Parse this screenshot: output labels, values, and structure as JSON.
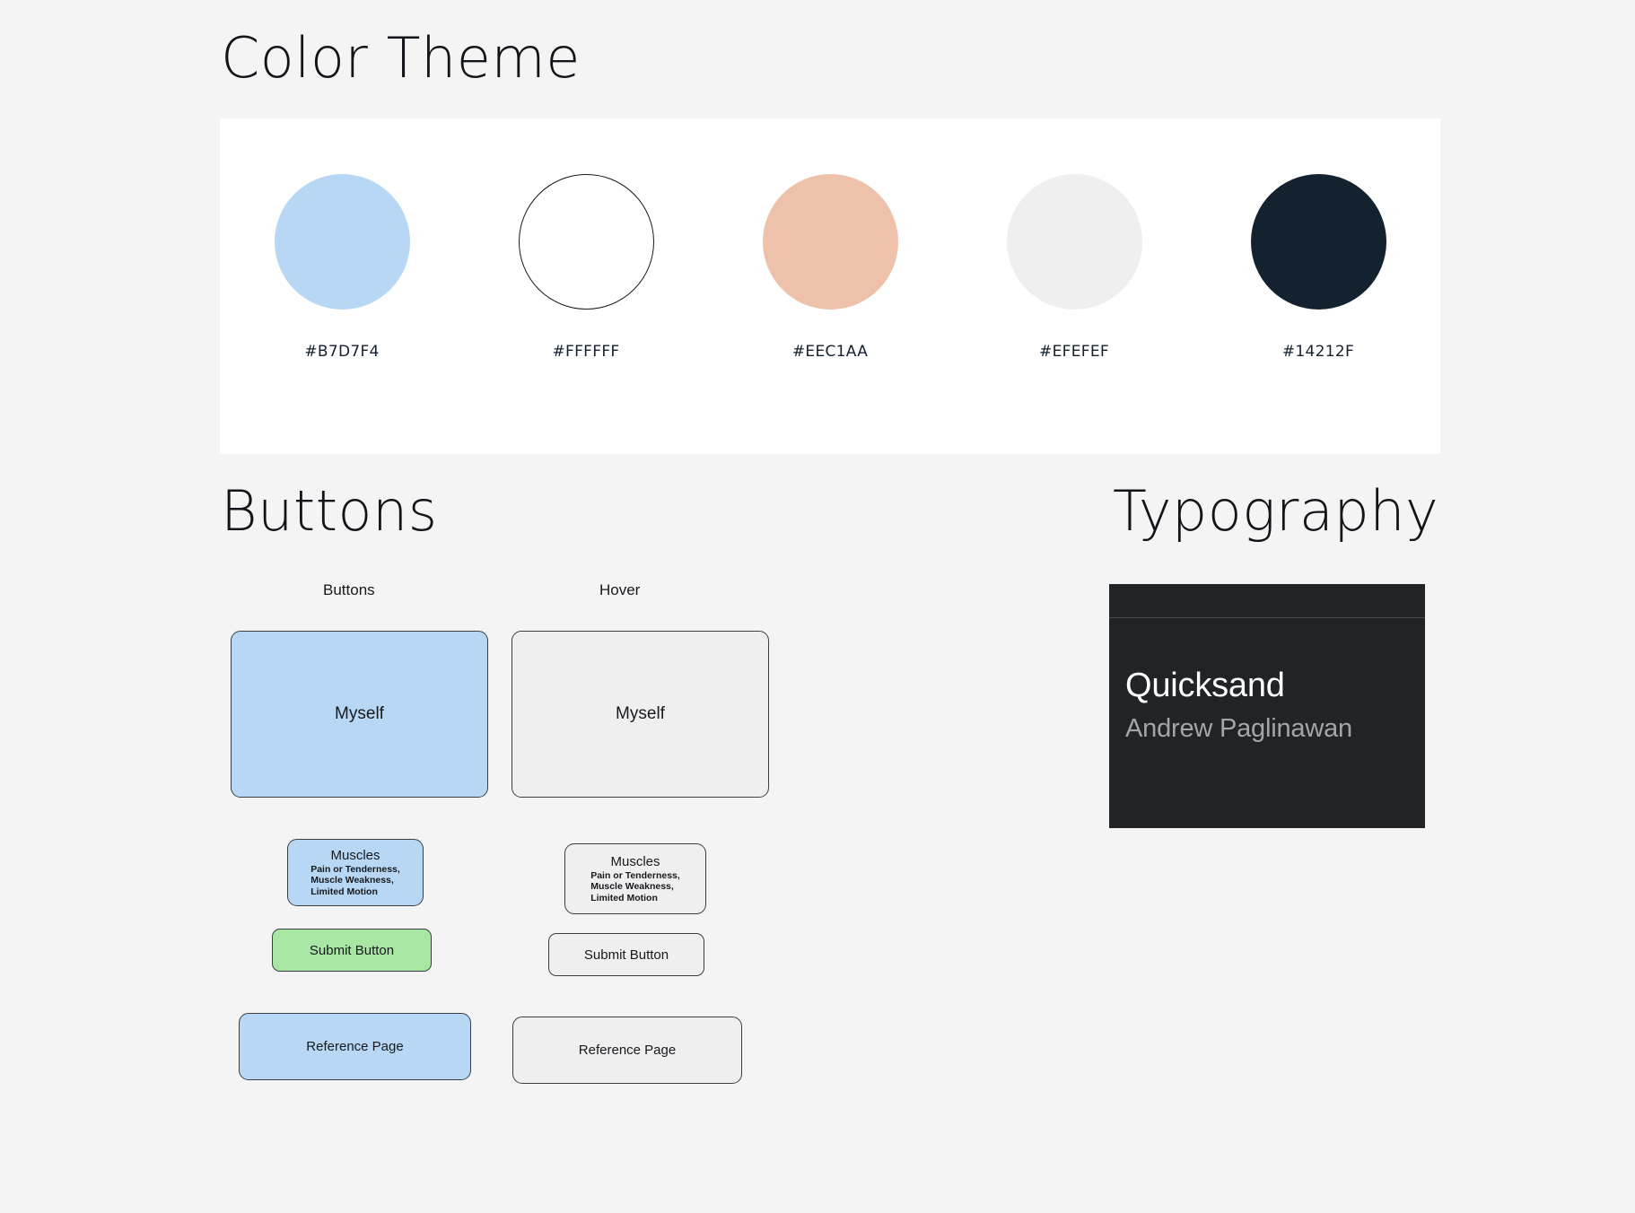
{
  "sections": {
    "color_theme": {
      "heading": "Color Theme",
      "swatches": [
        {
          "label": "#B7D7F4",
          "hex": "#B7D7F4",
          "outlined": false
        },
        {
          "label": "#FFFFFF",
          "hex": "#FFFFFF",
          "outlined": true
        },
        {
          "label": "#EEC1AA",
          "hex": "#EEC1AA",
          "outlined": false
        },
        {
          "label": "#EFEFEF",
          "hex": "#EFEFEF",
          "outlined": false
        },
        {
          "label": "#14212F",
          "hex": "#14212F",
          "outlined": false
        }
      ]
    },
    "buttons": {
      "heading": "Buttons",
      "column_labels": {
        "default": "Buttons",
        "hover": "Hover"
      },
      "items": {
        "myself": {
          "label": "Myself",
          "default_bg": "#B7D7F4",
          "hover_bg": "#EFEFEF"
        },
        "muscles": {
          "title": "Muscles",
          "subtitle": "Pain or Tenderness,\nMuscle Weakness,\nLimited Motion",
          "default_bg": "#B7D7F4",
          "hover_bg": "#EFEFEF"
        },
        "submit": {
          "label": "Submit Button",
          "default_bg": "#A8E6A3",
          "hover_bg": "#EFEFEF"
        },
        "reference": {
          "label": "Reference Page",
          "default_bg": "#B7D7F4",
          "hover_bg": "#EFEFEF"
        }
      }
    },
    "typography": {
      "heading": "Typography",
      "specimen": {
        "font_name": "Quicksand",
        "designer": "Andrew Paglinawan",
        "card_bg": "#212426",
        "name_color": "#FFFFFF",
        "designer_color": "#A3A6A9"
      }
    }
  }
}
